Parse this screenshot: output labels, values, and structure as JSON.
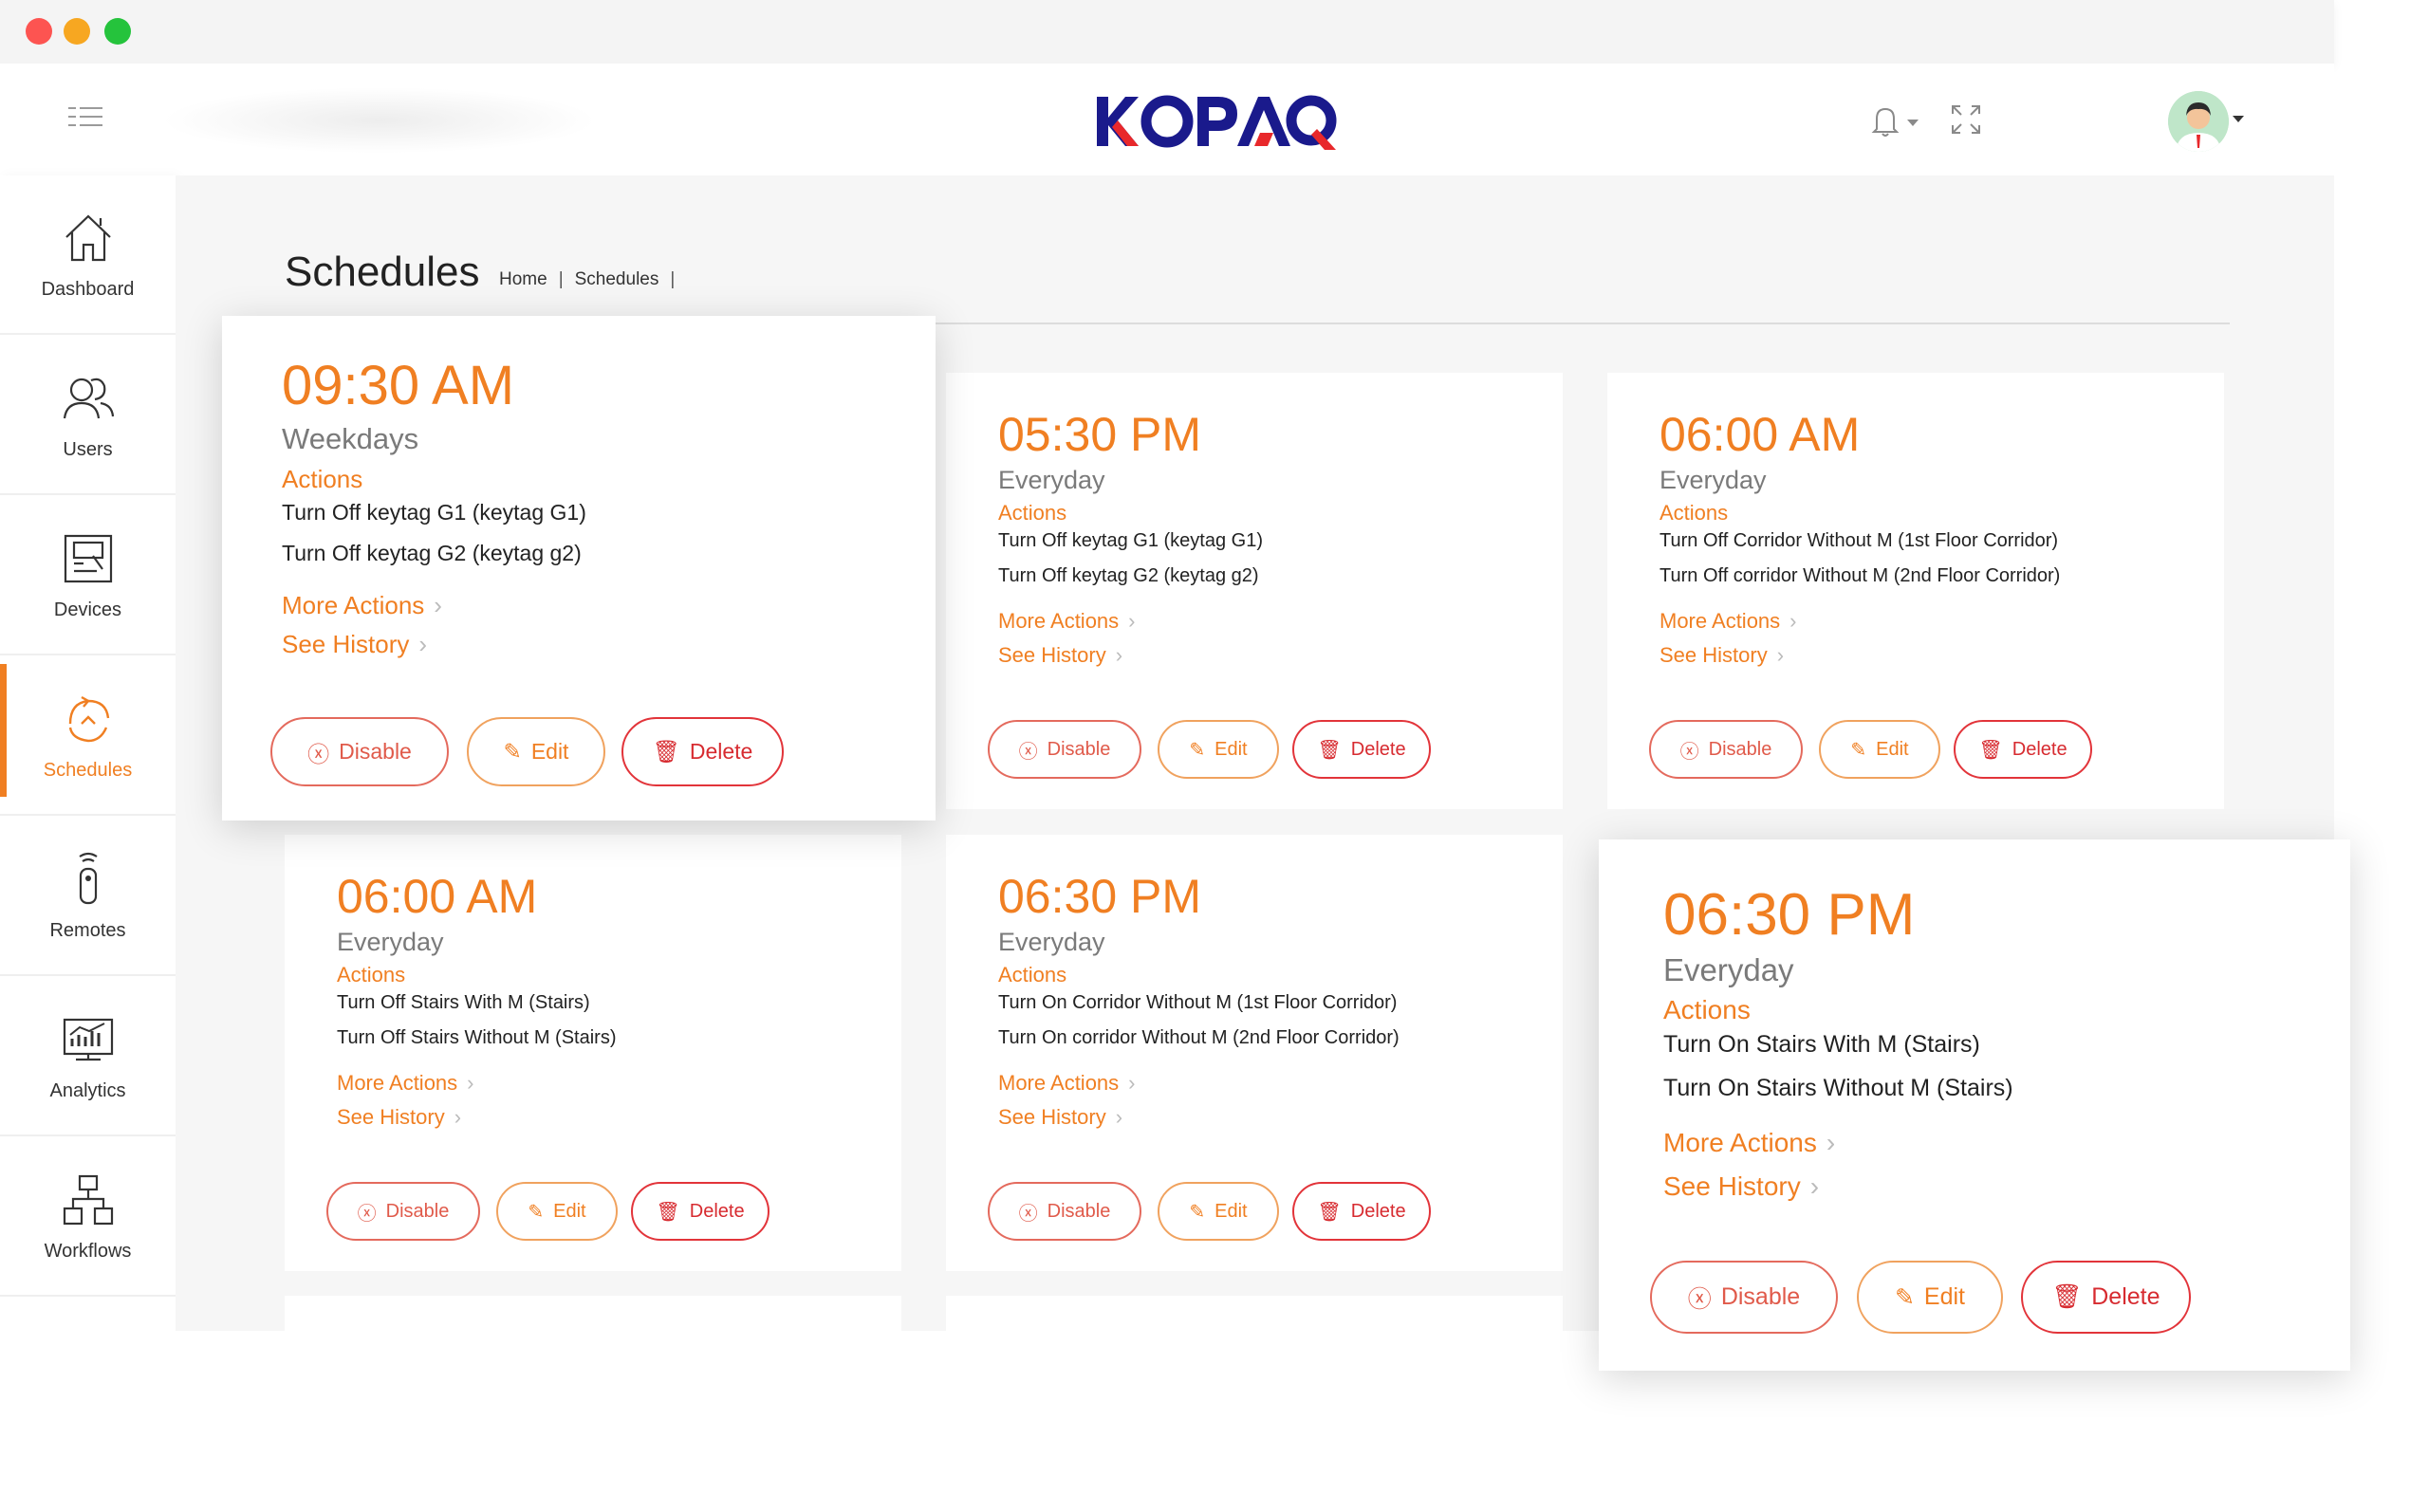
{
  "window": {
    "buttons": [
      "close",
      "minimize",
      "maximize"
    ]
  },
  "header": {
    "logo_text_a": "K",
    "logo_text_b": "OPA",
    "logo_text_c": "Q",
    "icons": [
      "menu-toggle-icon",
      "bell-icon",
      "expand-icon",
      "avatar"
    ]
  },
  "sidebar": {
    "items": [
      {
        "label": "Dashboard",
        "icon": "home-icon"
      },
      {
        "label": "Users",
        "icon": "users-icon"
      },
      {
        "label": "Devices",
        "icon": "device-icon"
      },
      {
        "label": "Schedules",
        "icon": "schedule-icon",
        "active": true
      },
      {
        "label": "Remotes",
        "icon": "remote-icon"
      },
      {
        "label": "Analytics",
        "icon": "analytics-icon"
      },
      {
        "label": "Workflows",
        "icon": "workflow-icon"
      }
    ]
  },
  "page": {
    "title": "Schedules",
    "breadcrumb": [
      "Home",
      "|",
      "Schedules",
      "|"
    ]
  },
  "labels": {
    "actions": "Actions",
    "more_actions": "More Actions",
    "see_history": "See History",
    "disable": "Disable",
    "edit": "Edit",
    "delete": "Delete"
  },
  "colors": {
    "accent": "#f07f22",
    "danger": "#d72b30",
    "logo_blue": "#1a1a8c",
    "logo_red": "#e8282b"
  },
  "cards": [
    {
      "time": "09:30 AM",
      "frequency": "Weekdays",
      "actions": [
        "Turn Off keytag G1 (keytag G1)",
        "Turn Off keytag G2 (keytag g2)"
      ]
    },
    {
      "time": "05:30 PM",
      "frequency": "Everyday",
      "actions": [
        "Turn Off keytag G1 (keytag G1)",
        "Turn Off keytag G2 (keytag g2)"
      ]
    },
    {
      "time": "06:00 AM",
      "frequency": "Everyday",
      "actions": [
        "Turn Off Corridor Without M (1st Floor Corridor)",
        "Turn Off corridor Without M (2nd Floor Corridor)"
      ]
    },
    {
      "time": "06:00 AM",
      "frequency": "Everyday",
      "actions": [
        "Turn Off Stairs With M (Stairs)",
        "Turn Off Stairs Without M (Stairs)"
      ]
    },
    {
      "time": "06:30 PM",
      "frequency": "Everyday",
      "actions": [
        "Turn On Corridor Without M (1st Floor Corridor)",
        "Turn On corridor Without M (2nd Floor Corridor)"
      ]
    },
    {
      "time": "06:30 PM",
      "frequency": "Everyday",
      "actions": [
        "Turn On Stairs With M (Stairs)",
        "Turn On Stairs Without M (Stairs)"
      ]
    }
  ]
}
